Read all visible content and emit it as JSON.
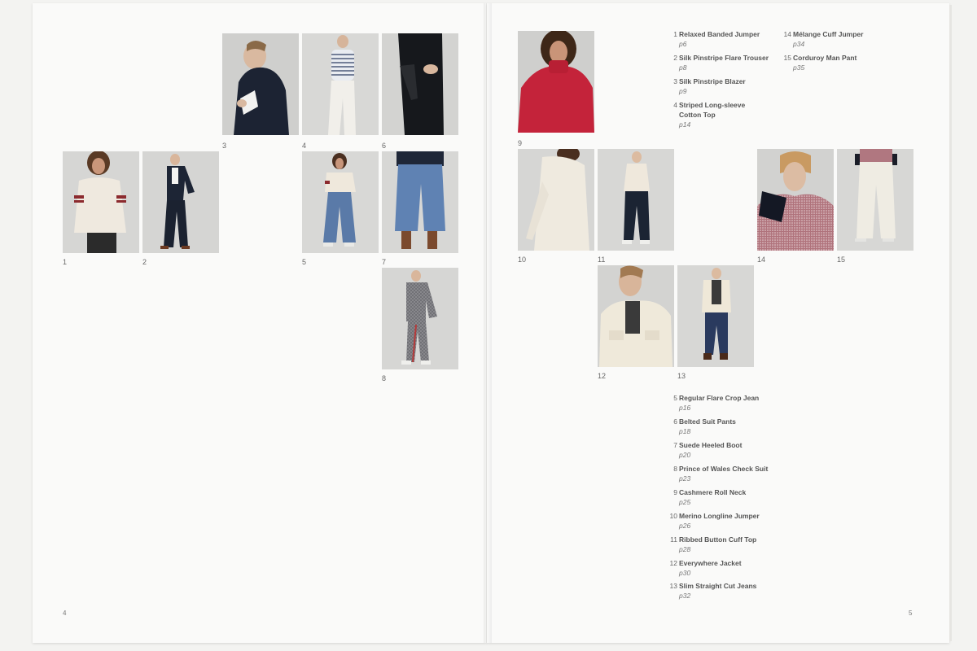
{
  "pages": {
    "left_number": "4",
    "right_number": "5"
  },
  "photos": [
    {
      "caption": "3"
    },
    {
      "caption": "4"
    },
    {
      "caption": "6"
    },
    {
      "caption": "1"
    },
    {
      "caption": "2"
    },
    {
      "caption": "5"
    },
    {
      "caption": "7"
    },
    {
      "caption": "8"
    },
    {
      "caption": "9"
    },
    {
      "caption": "10"
    },
    {
      "caption": "11"
    },
    {
      "caption": "14"
    },
    {
      "caption": "15"
    },
    {
      "caption": "12"
    },
    {
      "caption": "13"
    }
  ],
  "index_top_left": [
    {
      "num": "1",
      "title": "Relaxed Banded Jumper",
      "page": "p6"
    },
    {
      "num": "2",
      "title": "Silk Pinstripe Flare Trouser",
      "page": "p8"
    },
    {
      "num": "3",
      "title": "Silk Pinstripe Blazer",
      "page": "p9"
    },
    {
      "num": "4",
      "title": "Striped Long-sleeve",
      "title2": "Cotton Top",
      "page": "p14"
    }
  ],
  "index_top_right": [
    {
      "num": "14",
      "title": "Mélange Cuff Jumper",
      "page": "p34"
    },
    {
      "num": "15",
      "title": "Corduroy Man Pant",
      "page": "p35"
    }
  ],
  "index_bottom": [
    {
      "num": "5",
      "title": "Regular Flare Crop Jean",
      "page": "p16"
    },
    {
      "num": "6",
      "title": "Belted Suit Pants",
      "page": "p18"
    },
    {
      "num": "7",
      "title": "Suede Heeled Boot",
      "page": "p20"
    },
    {
      "num": "8",
      "title": "Prince of Wales Check Suit",
      "page": "p23"
    },
    {
      "num": "9",
      "title": "Cashmere Roll Neck",
      "page": "p25"
    },
    {
      "num": "10",
      "title": "Merino Longline Jumper",
      "page": "p26"
    },
    {
      "num": "11",
      "title": "Ribbed Button Cuff Top",
      "page": "p28"
    },
    {
      "num": "12",
      "title": "Everywhere Jacket",
      "page": "p30"
    },
    {
      "num": "13",
      "title": "Slim Straight Cut Jeans",
      "page": "p32"
    }
  ]
}
